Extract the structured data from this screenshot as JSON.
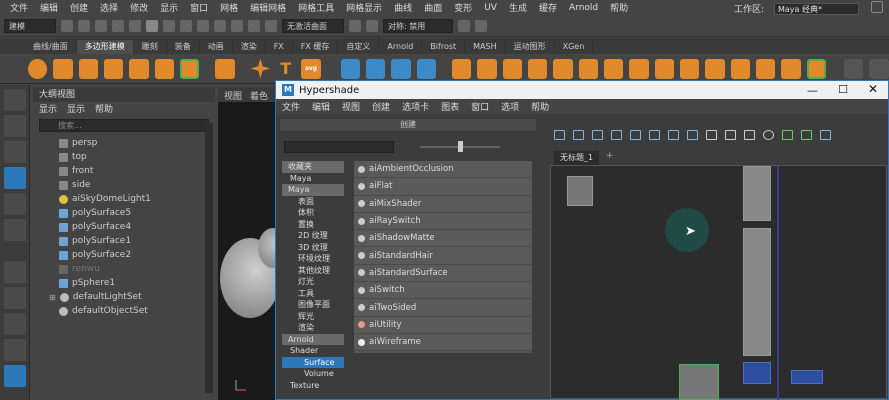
{
  "menubar": {
    "items": [
      "文件",
      "编辑",
      "创建",
      "选择",
      "修改",
      "显示",
      "窗口",
      "网格",
      "编辑网格",
      "网格工具",
      "网格显示",
      "曲线",
      "曲面",
      "变形",
      "UV",
      "生成",
      "缓存",
      "Arnold",
      "帮助"
    ],
    "workspace_label": "工作区:",
    "workspace_value": "Maya 经典*"
  },
  "statusline": {
    "mode": "建模",
    "no_live_surface": "无激活曲面",
    "symmetry": "对称: 禁用"
  },
  "shelf_tabs": [
    "曲线/曲面",
    "多边形建模",
    "雕刻",
    "装备",
    "动画",
    "渲染",
    "FX",
    "FX 缓存",
    "自定义",
    "Arnold",
    "Bifrost",
    "MASH",
    "运动图形",
    "XGen"
  ],
  "shelf_active": "多边形建模",
  "outliner": {
    "title": "大纲视图",
    "menu": [
      "显示",
      "显示",
      "帮助"
    ],
    "search_placeholder": "搜索...",
    "items": [
      "persp",
      "top",
      "front",
      "side",
      "aiSkyDomeLight1",
      "polySurface5",
      "polySurface4",
      "polySurface1",
      "polySurface2",
      "renwu",
      "pSphere1",
      "defaultLightSet",
      "defaultObjectSet"
    ]
  },
  "viewport_menu": [
    "视图",
    "着色"
  ],
  "hypershade": {
    "title": "Hypershade",
    "menu": [
      "文件",
      "编辑",
      "视图",
      "创建",
      "选项卡",
      "图表",
      "窗口",
      "选项",
      "帮助"
    ],
    "create_header": "创建",
    "categories": {
      "favorites": "收藏夹",
      "maya_fav": "Maya",
      "maya": "Maya",
      "maya_items": [
        "表面",
        "体积",
        "置换",
        "2D 纹理",
        "3D 纹理",
        "环境纹理",
        "其他纹理",
        "灯光",
        "工具",
        "图像平面",
        "辉光",
        "渲染"
      ],
      "arnold": "Arnold",
      "shader": "Shader",
      "surface": "Surface",
      "volume": "Volume",
      "texture": "Texture"
    },
    "nodes": [
      "aiAmbientOcclusion",
      "aiFlat",
      "aiMixShader",
      "aiRaySwitch",
      "aiShadowMatte",
      "aiStandardHair",
      "aiStandardSurface",
      "aiSwitch",
      "aiTwoSided",
      "aiUtility",
      "aiWireframe"
    ],
    "graph_tab": "无标题_1",
    "add_tab": "+"
  }
}
